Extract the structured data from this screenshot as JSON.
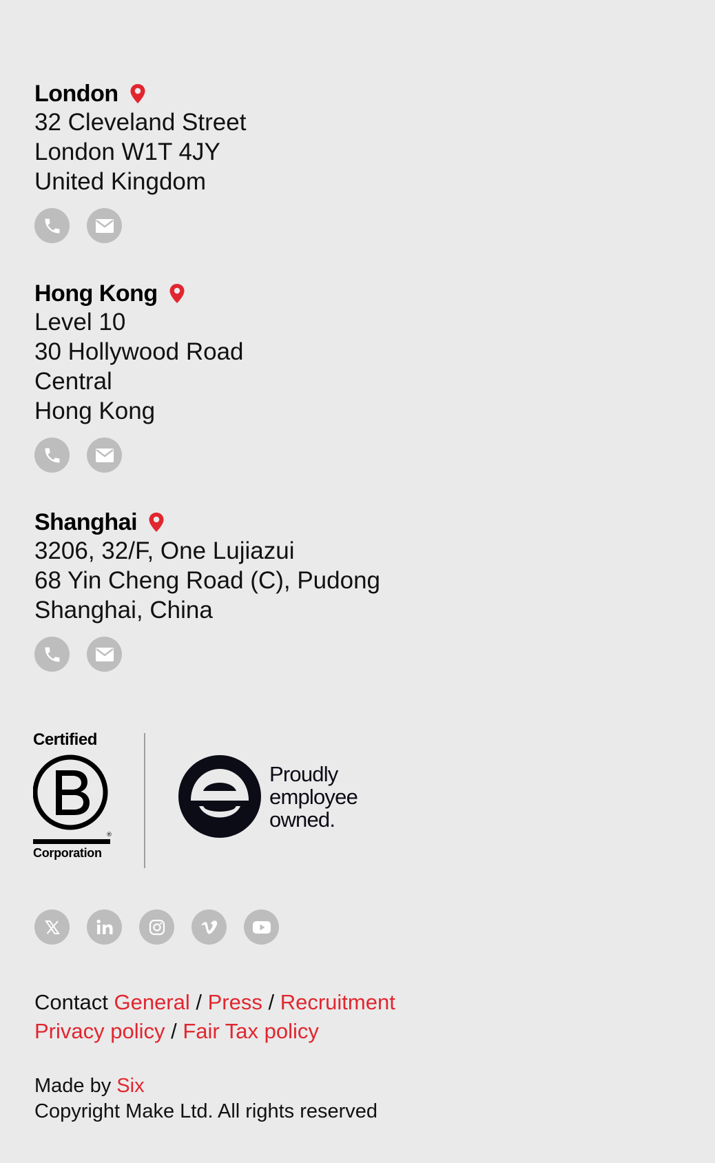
{
  "offices": [
    {
      "name": "London",
      "address": [
        "32 Cleveland Street",
        "London W1T 4JY",
        "United Kingdom"
      ]
    },
    {
      "name": "Hong Kong",
      "address": [
        "Level 10",
        "30 Hollywood Road",
        "Central",
        "Hong Kong"
      ]
    },
    {
      "name": "Shanghai",
      "address": [
        "3206, 32/F, One Lujiazui",
        "68 Yin Cheng Road (C), Pudong",
        "Shanghai, China"
      ]
    }
  ],
  "icons": {
    "location": "map-pin-icon",
    "phone": "phone-icon",
    "email": "email-icon"
  },
  "badges": {
    "bcorp": {
      "top_text": "Certified",
      "bottom_text": "Corporation"
    },
    "employee_owned": {
      "lines": [
        "Proudly",
        "employee",
        "owned."
      ]
    }
  },
  "social": [
    {
      "name": "x-icon"
    },
    {
      "name": "linkedin-icon"
    },
    {
      "name": "instagram-icon"
    },
    {
      "name": "vimeo-icon"
    },
    {
      "name": "youtube-icon"
    }
  ],
  "footer_links": {
    "contact_label": "Contact",
    "separator": " / ",
    "general": "General",
    "press": "Press",
    "recruitment": "Recruitment",
    "privacy": "Privacy policy",
    "fair_tax": "Fair Tax policy"
  },
  "credits": {
    "made_by_label": "Made by ",
    "made_by_link": "Six",
    "copyright": "Copyright Make Ltd. All rights reserved"
  },
  "colors": {
    "background": "#eaeaea",
    "accent_red": "#e1262f",
    "icon_circle": "#bdbdbd",
    "text": "#111111"
  }
}
